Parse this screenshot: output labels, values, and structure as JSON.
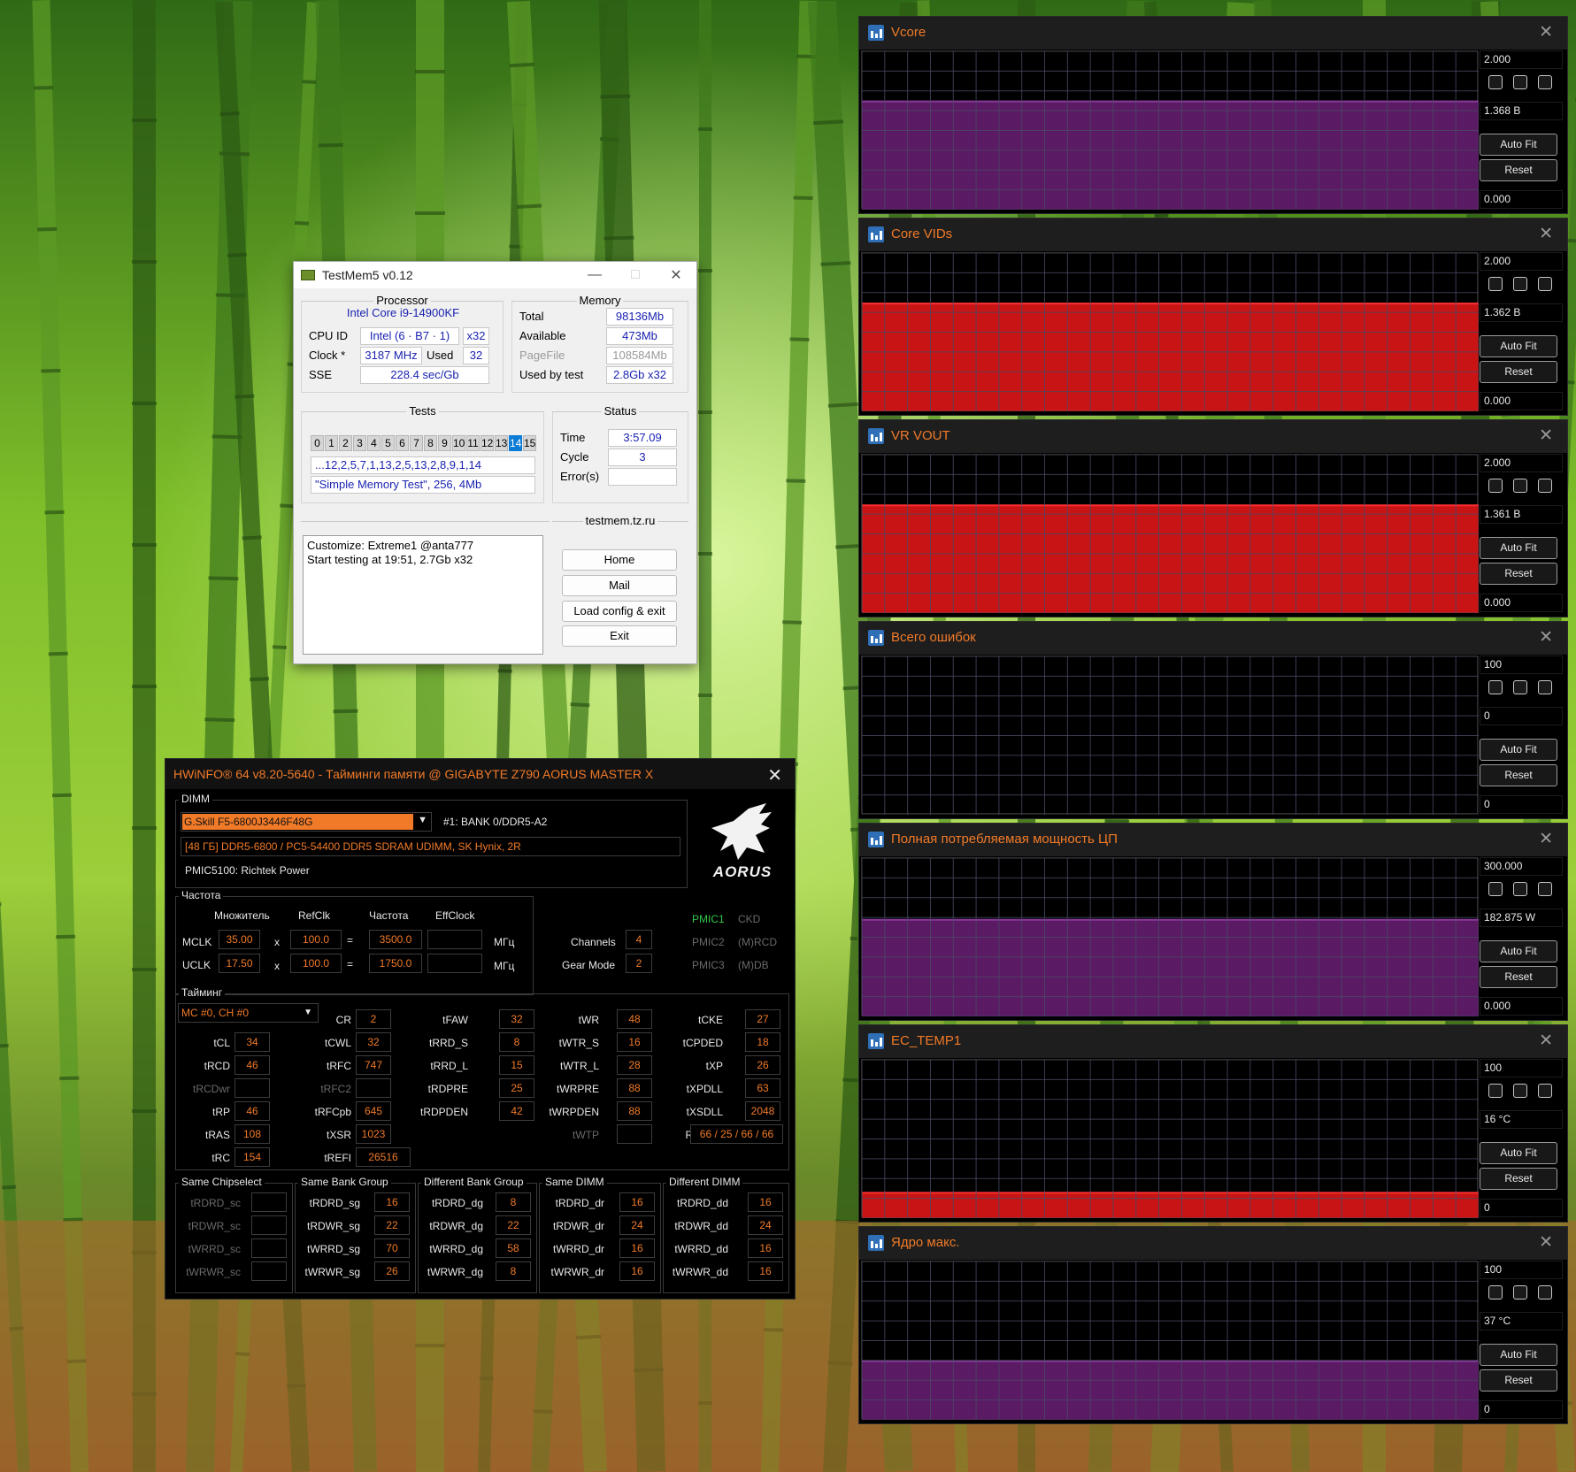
{
  "colors": {
    "hwinfo_accent": "#f07a28",
    "testmem_value": "#1a22b0",
    "graph_red": "#c81414",
    "graph_purple": "#5a1a64",
    "pmic_active": "#35c84a"
  },
  "testmem": {
    "title": "TestMem5 v0.12",
    "processor": {
      "label": "Processor",
      "name": "Intel Core i9-14900KF",
      "cpu_id_label": "CPU ID",
      "cpu_id": "Intel  (6 · B7 · 1)",
      "threads": "x32",
      "clock_label": "Clock *",
      "clock": "3187 MHz",
      "used_label": "Used",
      "used": "32",
      "sse_label": "SSE",
      "sse": "228.4 sec/Gb"
    },
    "memory": {
      "label": "Memory",
      "total_label": "Total",
      "total": "98136Mb",
      "available_label": "Available",
      "available": "473Mb",
      "pagefile_label": "PageFile",
      "pagefile": "108584Mb",
      "usedby_label": "Used by test",
      "usedby": "2.8Gb x32"
    },
    "tests": {
      "label": "Tests",
      "numbers": [
        "0",
        "1",
        "2",
        "3",
        "4",
        "5",
        "6",
        "7",
        "8",
        "9",
        "10",
        "11",
        "12",
        "13",
        "14",
        "15"
      ],
      "selected": "14",
      "sequence": "...12,2,5,7,1,13,2,5,13,2,8,9,1,14",
      "current": "\"Simple Memory Test\", 256, 4Mb"
    },
    "status": {
      "label": "Status",
      "time_label": "Time",
      "time": "3:57.09",
      "cycle_label": "Cycle",
      "cycle": "3",
      "errors_label": "Error(s)",
      "errors": ""
    },
    "log": "Customize: Extreme1 @anta777\nStart testing at 19:51, 2.7Gb x32",
    "site": "testmem.tz.ru",
    "buttons": {
      "home": "Home",
      "mail": "Mail",
      "load": "Load config & exit",
      "exit": "Exit"
    }
  },
  "hwinfo": {
    "title": "HWiNFO® 64 v8.20-5640 - Тайминги памяти @ GIGABYTE Z790 AORUS MASTER X",
    "logo_text": "AORUS",
    "dimm": {
      "label": "DIMM",
      "module": "G.Skill F5-6800J3446F48G",
      "slot": "#1: BANK 0/DDR5-A2",
      "description": "[48 ГБ] DDR5-6800 / PC5-54400 DDR5 SDRAM UDIMM, SK Hynix, 2R",
      "pmic": "PMIC5100: Richtek Power"
    },
    "freq": {
      "label": "Частота",
      "h_mult": "Множитель",
      "h_refclk": "RefClk",
      "h_freq": "Частота",
      "h_eff": "EffClock",
      "mclk_label": "MCLK",
      "mclk_mult": "35.00",
      "mclk_ref": "100.0",
      "mclk_freq": "3500.0",
      "uclk_label": "UCLK",
      "uclk_mult": "17.50",
      "uclk_ref": "100.0",
      "uclk_freq": "1750.0",
      "x": "x",
      "eq": "=",
      "unit": "МГц",
      "channels_label": "Channels",
      "channels": "4",
      "gear_label": "Gear Mode",
      "gear": "2"
    },
    "pmic": {
      "pmic1": "PMIC1",
      "ckd": "CKD",
      "pmic2": "PMIC2",
      "rcd": "(M)RCD",
      "pmic3": "PMIC3",
      "db": "(M)DB"
    },
    "timing": {
      "label": "Тайминг",
      "mc": "MC #0, CH #0",
      "tCL": {
        "l": "tCL",
        "v": "34"
      },
      "tRCD": {
        "l": "tRCD",
        "v": "46"
      },
      "tRCDwr": {
        "l": "tRCDwr",
        "v": ""
      },
      "tRP": {
        "l": "tRP",
        "v": "46"
      },
      "tRAS": {
        "l": "tRAS",
        "v": "108"
      },
      "tRC": {
        "l": "tRC",
        "v": "154"
      },
      "CR": {
        "l": "CR",
        "v": "2"
      },
      "tCWL": {
        "l": "tCWL",
        "v": "32"
      },
      "tRFC": {
        "l": "tRFC",
        "v": "747"
      },
      "tRFC2": {
        "l": "tRFC2",
        "v": ""
      },
      "tRFCpb": {
        "l": "tRFCpb",
        "v": "645"
      },
      "tXSR": {
        "l": "tXSR",
        "v": "1023"
      },
      "tREFI": {
        "l": "tREFI",
        "v": "26516"
      },
      "tFAW": {
        "l": "tFAW",
        "v": "32"
      },
      "tRRD_S": {
        "l": "tRRD_S",
        "v": "8"
      },
      "tRRD_L": {
        "l": "tRRD_L",
        "v": "15"
      },
      "tRDPRE": {
        "l": "tRDPRE",
        "v": "25"
      },
      "tRDPDEN": {
        "l": "tRDPDEN",
        "v": "42"
      },
      "tWR": {
        "l": "tWR",
        "v": "48"
      },
      "tWTR_S": {
        "l": "tWTR_S",
        "v": "16"
      },
      "tWTR_L": {
        "l": "tWTR_L",
        "v": "28"
      },
      "tWRPRE": {
        "l": "tWRPRE",
        "v": "88"
      },
      "tWRPDEN": {
        "l": "tWRPDEN",
        "v": "88"
      },
      "tWTP": {
        "l": "tWTP",
        "v": ""
      },
      "tCKE": {
        "l": "tCKE",
        "v": "27"
      },
      "tCPDED": {
        "l": "tCPDED",
        "v": "18"
      },
      "tXP": {
        "l": "tXP",
        "v": "26"
      },
      "tXPDLL": {
        "l": "tXPDLL",
        "v": "63"
      },
      "tXSDLL": {
        "l": "tXSDLL",
        "v": "2048"
      },
      "RTL": {
        "l": "RTL",
        "v": "66 / 25 / 66 / 66"
      }
    },
    "groups": {
      "same_cs": {
        "label": "Same Chipselect",
        "rows": [
          {
            "l": "tRDRD_sc",
            "v": ""
          },
          {
            "l": "tRDWR_sc",
            "v": ""
          },
          {
            "l": "tWRRD_sc",
            "v": ""
          },
          {
            "l": "tWRWR_sc",
            "v": ""
          }
        ]
      },
      "same_bg": {
        "label": "Same Bank Group",
        "rows": [
          {
            "l": "tRDRD_sg",
            "v": "16"
          },
          {
            "l": "tRDWR_sg",
            "v": "22"
          },
          {
            "l": "tWRRD_sg",
            "v": "70"
          },
          {
            "l": "tWRWR_sg",
            "v": "26"
          }
        ]
      },
      "diff_bg": {
        "label": "Different Bank Group",
        "rows": [
          {
            "l": "tRDRD_dg",
            "v": "8"
          },
          {
            "l": "tRDWR_dg",
            "v": "22"
          },
          {
            "l": "tWRRD_dg",
            "v": "58"
          },
          {
            "l": "tWRWR_dg",
            "v": "8"
          }
        ]
      },
      "same_dimm": {
        "label": "Same DIMM",
        "rows": [
          {
            "l": "tRDRD_dr",
            "v": "16"
          },
          {
            "l": "tRDWR_dr",
            "v": "24"
          },
          {
            "l": "tWRRD_dr",
            "v": "16"
          },
          {
            "l": "tWRWR_dr",
            "v": "16"
          }
        ]
      },
      "diff_dimm": {
        "label": "Different DIMM",
        "rows": [
          {
            "l": "tRDRD_dd",
            "v": "16"
          },
          {
            "l": "tRDWR_dd",
            "v": "24"
          },
          {
            "l": "tWRRD_dd",
            "v": "16"
          },
          {
            "l": "tWRWR_dd",
            "v": "16"
          }
        ]
      }
    }
  },
  "graphs": [
    {
      "title": "Vcore",
      "max": "2.000",
      "current": "1.368 В",
      "min": "0.000",
      "style": "purple",
      "level": 0.684,
      "autofit": "Auto Fit",
      "reset": "Reset"
    },
    {
      "title": "Core VIDs",
      "max": "2.000",
      "current": "1.362 В",
      "min": "0.000",
      "style": "red",
      "level": 0.681,
      "autofit": "Auto Fit",
      "reset": "Reset"
    },
    {
      "title": "VR VOUT",
      "max": "2.000",
      "current": "1.361 В",
      "min": "0.000",
      "style": "red",
      "level": 0.68,
      "autofit": "Auto Fit",
      "reset": "Reset"
    },
    {
      "title": "Всего ошибок",
      "max": "100",
      "current": "0",
      "min": "0",
      "style": "none",
      "level": 0,
      "autofit": "Auto Fit",
      "reset": "Reset"
    },
    {
      "title": "Полная потребляемая мощность ЦП",
      "max": "300.000",
      "current": "182.875 W",
      "min": "0.000",
      "style": "purple",
      "level": 0.61,
      "autofit": "Auto Fit",
      "reset": "Reset"
    },
    {
      "title": "EC_TEMP1",
      "max": "100",
      "current": "16 °C",
      "min": "0",
      "style": "red",
      "level": 0.16,
      "autofit": "Auto Fit",
      "reset": "Reset"
    },
    {
      "title": "Ядро макс.",
      "max": "100",
      "current": "37 °C",
      "min": "0",
      "style": "purple",
      "level": 0.37,
      "autofit": "Auto Fit",
      "reset": "Reset"
    }
  ]
}
